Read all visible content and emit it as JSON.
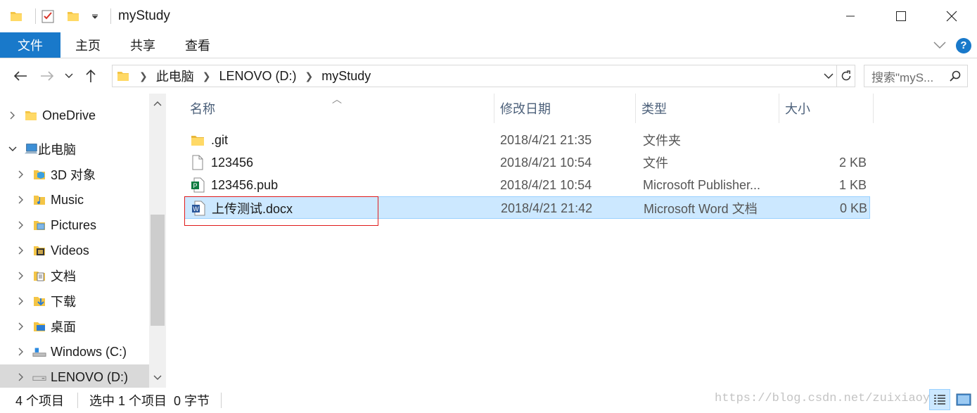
{
  "window": {
    "title": "myStudy"
  },
  "ribbon": {
    "tabs": [
      "文件",
      "主页",
      "共享",
      "查看"
    ],
    "help": "?"
  },
  "address": {
    "crumbs": [
      "此电脑",
      "LENOVO (D:)",
      "myStudy"
    ],
    "search_placeholder": "搜索\"myS..."
  },
  "nav_tree": [
    {
      "label": "OneDrive",
      "icon": "folder-icon",
      "expanded": false
    },
    {
      "label": "此电脑",
      "icon": "computer-icon",
      "expanded": true
    },
    {
      "label": "3D 对象",
      "icon": "3d-objects-icon",
      "expanded": false
    },
    {
      "label": "Music",
      "icon": "music-folder-icon",
      "expanded": false
    },
    {
      "label": "Pictures",
      "icon": "pictures-folder-icon",
      "expanded": false
    },
    {
      "label": "Videos",
      "icon": "videos-folder-icon",
      "expanded": false
    },
    {
      "label": "文档",
      "icon": "documents-folder-icon",
      "expanded": false
    },
    {
      "label": "下载",
      "icon": "downloads-folder-icon",
      "expanded": false
    },
    {
      "label": "桌面",
      "icon": "desktop-folder-icon",
      "expanded": false
    },
    {
      "label": "Windows (C:)",
      "icon": "drive-icon",
      "expanded": false
    },
    {
      "label": "LENOVO (D:)",
      "icon": "drive-icon",
      "expanded": false,
      "selected": true
    }
  ],
  "columns": [
    "名称",
    "修改日期",
    "类型",
    "大小"
  ],
  "files": [
    {
      "name": ".git",
      "date": "2018/4/21 21:35",
      "type": "文件夹",
      "size": "",
      "icon": "folder-icon"
    },
    {
      "name": "123456",
      "date": "2018/4/21 10:54",
      "type": "文件",
      "size": "2 KB",
      "icon": "file-icon"
    },
    {
      "name": "123456.pub",
      "date": "2018/4/21 10:54",
      "type": "Microsoft Publisher...",
      "size": "1 KB",
      "icon": "publisher-icon"
    },
    {
      "name": "上传测试.docx",
      "date": "2018/4/21 21:42",
      "type": "Microsoft Word 文档",
      "size": "0 KB",
      "icon": "word-icon",
      "selected": true
    }
  ],
  "status": {
    "count": "4 个项目",
    "selection": "选中 1 个项目  0 字节"
  },
  "watermark": "https://blog.csdn.net/zuixiaoy",
  "colors": {
    "accent": "#1979ca",
    "selection": "#cce8ff",
    "highlight_box": "#e01b1b"
  }
}
